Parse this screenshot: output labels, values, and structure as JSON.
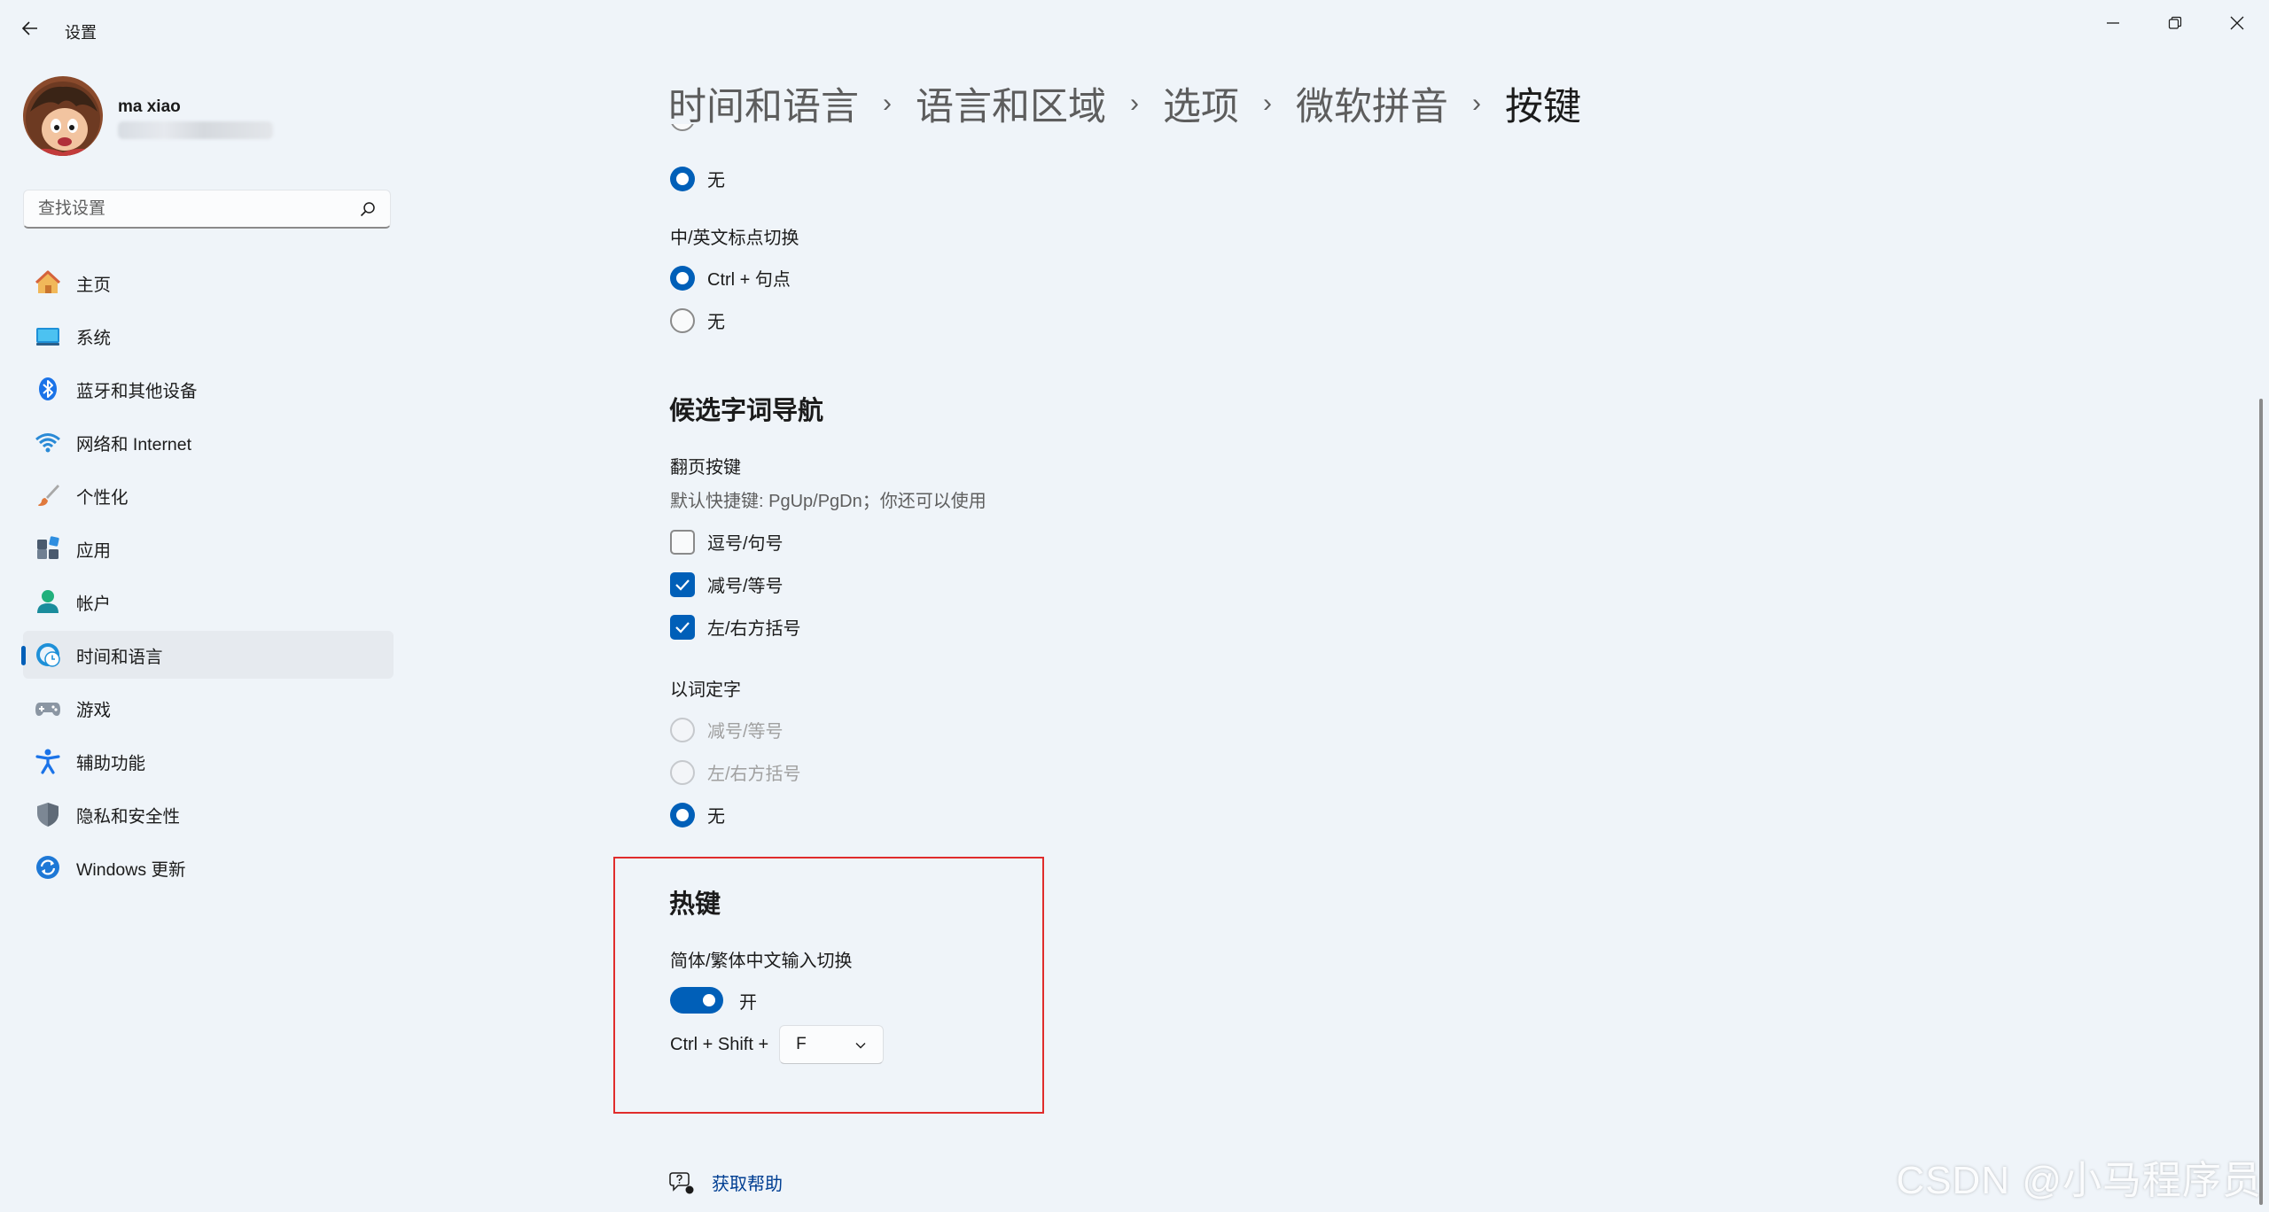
{
  "window": {
    "title": "设置"
  },
  "profile": {
    "name": "ma xiao"
  },
  "search": {
    "placeholder": "查找设置"
  },
  "sidebar": {
    "items": [
      {
        "label": "主页",
        "icon": "home-icon"
      },
      {
        "label": "系统",
        "icon": "system-icon"
      },
      {
        "label": "蓝牙和其他设备",
        "icon": "bluetooth-icon"
      },
      {
        "label": "网络和 Internet",
        "icon": "wifi-icon"
      },
      {
        "label": "个性化",
        "icon": "brush-icon"
      },
      {
        "label": "应用",
        "icon": "apps-icon"
      },
      {
        "label": "帐户",
        "icon": "account-icon"
      },
      {
        "label": "时间和语言",
        "icon": "time-language-icon",
        "selected": true
      },
      {
        "label": "游戏",
        "icon": "gamepad-icon"
      },
      {
        "label": "辅助功能",
        "icon": "accessibility-icon"
      },
      {
        "label": "隐私和安全性",
        "icon": "shield-icon"
      },
      {
        "label": "Windows 更新",
        "icon": "update-icon"
      }
    ]
  },
  "breadcrumb": {
    "items": [
      "时间和语言",
      "语言和区域",
      "选项",
      "微软拼音",
      "按键"
    ],
    "separator": "›"
  },
  "content": {
    "prev_option_none": {
      "label": "无",
      "checked": true
    },
    "punct_switch": {
      "title": "中/英文标点切换",
      "options": [
        {
          "label": "Ctrl + 句点",
          "checked": true
        },
        {
          "label": "无",
          "checked": false
        }
      ]
    },
    "candidate_nav": {
      "heading": "候选字词导航",
      "page_keys_title": "翻页按键",
      "page_keys_desc": "默认快捷键: PgUp/PgDn；你还可以使用",
      "page_keys": [
        {
          "label": "逗号/句号",
          "checked": false
        },
        {
          "label": "减号/等号",
          "checked": true
        },
        {
          "label": "左/右方括号",
          "checked": true
        }
      ],
      "select_word_title": "以词定字",
      "select_word": [
        {
          "label": "减号/等号",
          "checked": false,
          "disabled": true
        },
        {
          "label": "左/右方括号",
          "checked": false,
          "disabled": true
        },
        {
          "label": "无",
          "checked": true,
          "disabled": false
        }
      ]
    },
    "hotkeys": {
      "heading": "热键",
      "switch_title": "简体/繁体中文输入切换",
      "toggle_on": true,
      "toggle_label": "开",
      "shortcut_prefix": "Ctrl + Shift +",
      "shortcut_key": "F"
    },
    "help_link": "获取帮助"
  },
  "colors": {
    "accent": "#005fb8",
    "highlight_border": "#e02c2c",
    "background": "#eff4f9"
  },
  "watermark": "CSDN @小马程序员"
}
